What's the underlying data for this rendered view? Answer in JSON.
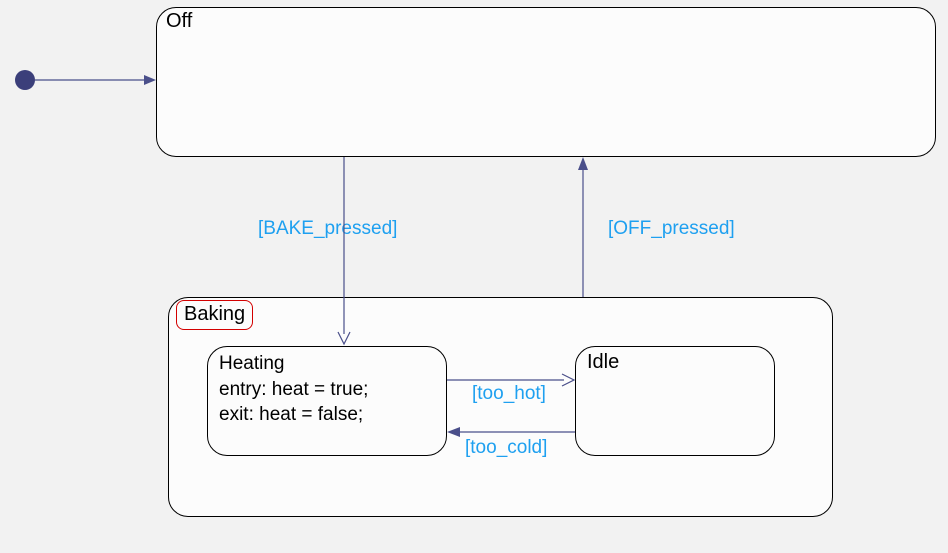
{
  "diagram": {
    "type": "statechart",
    "initial": "Off",
    "states": {
      "off": {
        "label": "Off"
      },
      "baking": {
        "label": "Baking",
        "substates": {
          "heating": {
            "label": "Heating",
            "entry": "entry: heat = true;",
            "exit": "exit: heat = false;"
          },
          "idle": {
            "label": "Idle"
          }
        }
      }
    },
    "transitions": {
      "bake_pressed": "[BAKE_pressed]",
      "off_pressed": "[OFF_pressed]",
      "too_hot": "[too_hot]",
      "too_cold": "[too_cold]"
    }
  }
}
